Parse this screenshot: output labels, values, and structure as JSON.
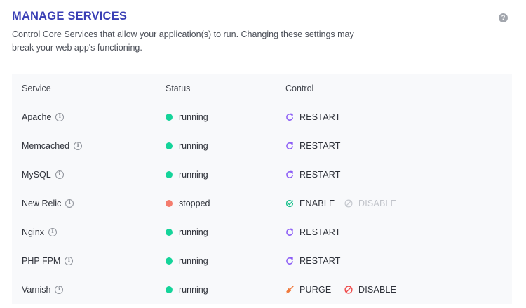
{
  "header": {
    "title": "MANAGE SERVICES",
    "description": "Control Core Services that allow your application(s) to run. Changing these settings may break your web app's functioning.",
    "help_glyph": "?"
  },
  "table": {
    "columns": {
      "service": "Service",
      "status": "Status",
      "control": "Control"
    },
    "rows": [
      {
        "service": "Apache",
        "status": "running",
        "actions": [
          {
            "label": "RESTART",
            "icon": "restart-icon",
            "enabled": true
          }
        ]
      },
      {
        "service": "Memcached",
        "status": "running",
        "actions": [
          {
            "label": "RESTART",
            "icon": "restart-icon",
            "enabled": true
          }
        ]
      },
      {
        "service": "MySQL",
        "status": "running",
        "actions": [
          {
            "label": "RESTART",
            "icon": "restart-icon",
            "enabled": true
          }
        ]
      },
      {
        "service": "New Relic",
        "status": "stopped",
        "actions": [
          {
            "label": "ENABLE",
            "icon": "check-icon",
            "enabled": true
          },
          {
            "label": "DISABLE",
            "icon": "disable-icon",
            "enabled": false
          }
        ]
      },
      {
        "service": "Nginx",
        "status": "running",
        "actions": [
          {
            "label": "RESTART",
            "icon": "restart-icon",
            "enabled": true
          }
        ]
      },
      {
        "service": "PHP FPM",
        "status": "running",
        "actions": [
          {
            "label": "RESTART",
            "icon": "restart-icon",
            "enabled": true
          }
        ]
      },
      {
        "service": "Varnish",
        "status": "running",
        "actions": [
          {
            "label": "PURGE",
            "icon": "broom-icon",
            "enabled": true
          },
          {
            "label": "DISABLE",
            "icon": "disable-icon",
            "enabled": true
          }
        ]
      }
    ]
  },
  "colors": {
    "title": "#3a3fb5",
    "running": "#15d49a",
    "stopped": "#f47c6d",
    "restart_icon": "#8b5cf6",
    "enable_icon": "#15c08a",
    "purge_icon": "#f07a3c",
    "disable_active": "#ef4a4a",
    "disable_inactive": "#c7cad0"
  }
}
